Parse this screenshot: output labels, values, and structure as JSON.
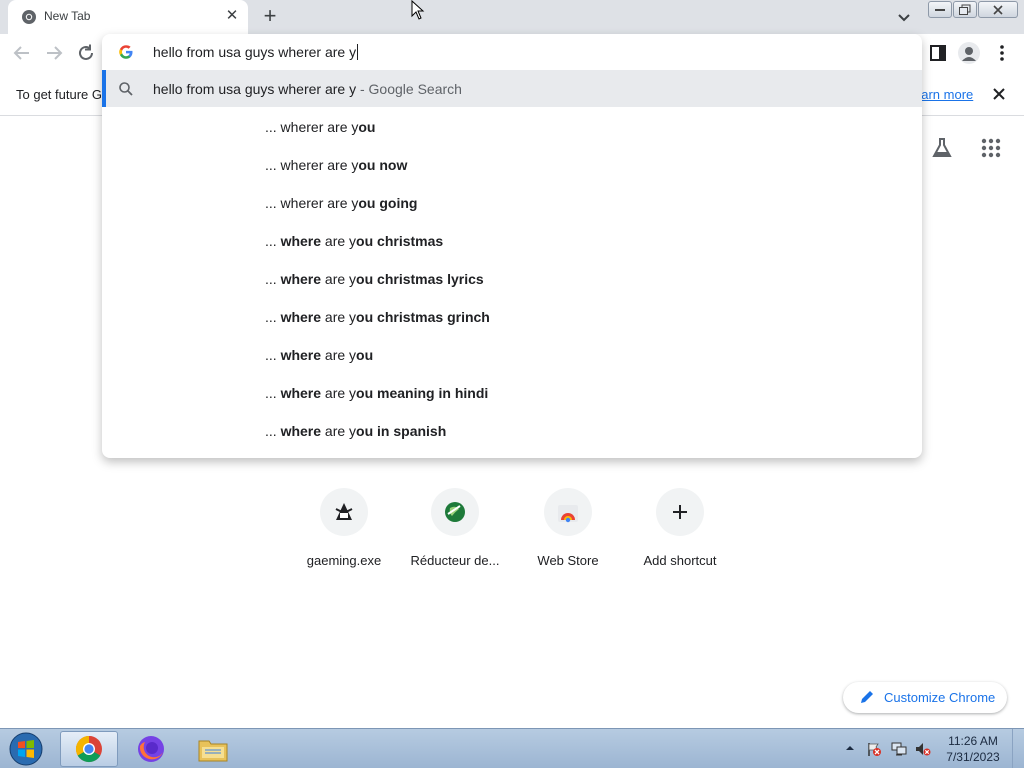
{
  "tab": {
    "title": "New Tab",
    "close_glyph": "✕",
    "new_tab_glyph": "+"
  },
  "infobar": {
    "text": "To get future G",
    "learn_more": "earn more"
  },
  "omnibox": {
    "input": "hello from usa guys wherer are y",
    "first_suggestion": {
      "text": "hello from usa guys wherer are y",
      "suffix": " - Google Search"
    },
    "suggestions": [
      {
        "prefix": "... wherer are y",
        "bold_where": false,
        "rest": "ou"
      },
      {
        "prefix": "... wherer are y",
        "bold_where": false,
        "rest": "ou now"
      },
      {
        "prefix": "... wherer are y",
        "bold_where": false,
        "rest": "ou going"
      },
      {
        "lead": "... ",
        "where": "where",
        "mid": " are y",
        "rest": "ou christmas"
      },
      {
        "lead": "... ",
        "where": "where",
        "mid": " are y",
        "rest": "ou christmas lyrics"
      },
      {
        "lead": "... ",
        "where": "where",
        "mid": " are y",
        "rest": "ou christmas grinch"
      },
      {
        "lead": "... ",
        "where": "where",
        "mid": " are y",
        "rest": "ou"
      },
      {
        "lead": "... ",
        "where": "where",
        "mid": " are y",
        "rest": "ou meaning in hindi"
      },
      {
        "lead": "... ",
        "where": "where",
        "mid": " are y",
        "rest": "ou in spanish"
      }
    ]
  },
  "shortcuts": [
    {
      "label": "gaeming.exe",
      "icon": "gaeming-favicon"
    },
    {
      "label": "Réducteur de...",
      "icon": "globe-favicon"
    },
    {
      "label": "Web Store",
      "icon": "web-store-icon"
    },
    {
      "label": "Add shortcut",
      "icon": "plus-icon"
    }
  ],
  "customize": {
    "label": "Customize Chrome"
  },
  "taskbar": {
    "time": "11:26 AM",
    "date": "7/31/2023"
  },
  "colors": {
    "accent": "#1a73e8",
    "titlebar": "#dee1e6",
    "taskbar": "#b6cbe1"
  }
}
